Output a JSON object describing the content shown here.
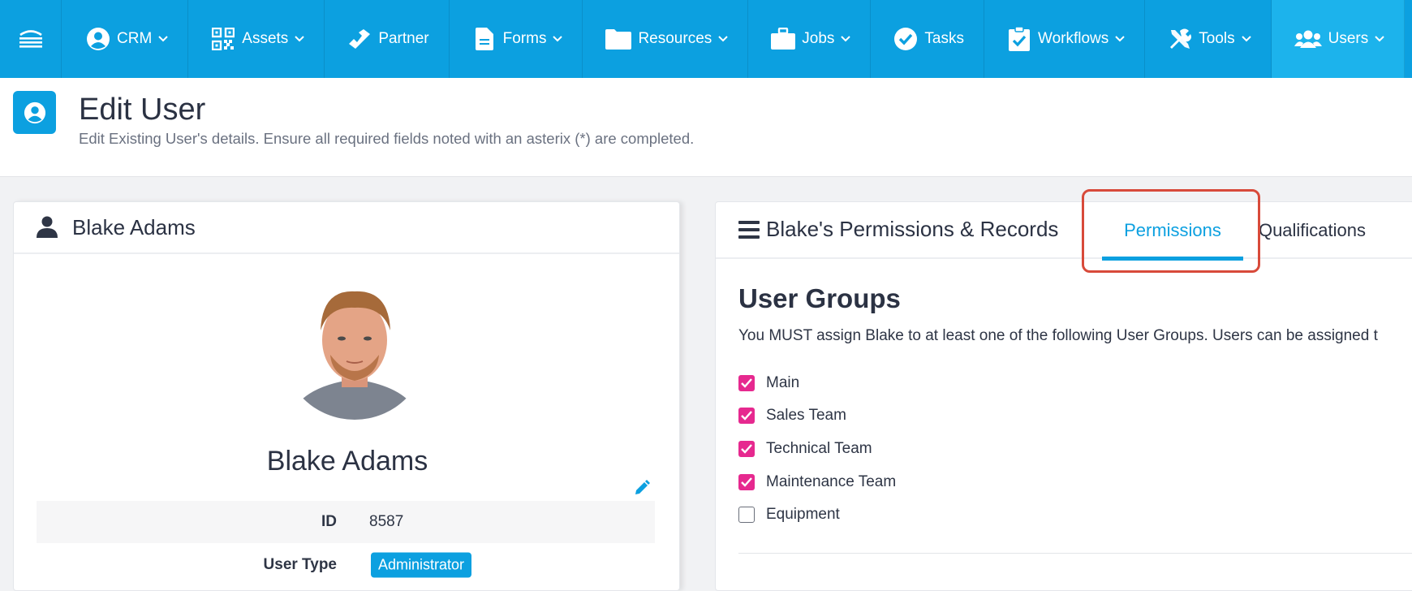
{
  "nav": {
    "logo_icon": "stack-layers-icon",
    "items": [
      {
        "label": "CRM",
        "icon": "user-circle-icon",
        "dropdown": true
      },
      {
        "label": "Assets",
        "icon": "qr-code-icon",
        "dropdown": true
      },
      {
        "label": "Partner",
        "icon": "handshake-icon",
        "dropdown": false
      },
      {
        "label": "Forms",
        "icon": "document-icon",
        "dropdown": true
      },
      {
        "label": "Resources",
        "icon": "folder-icon",
        "dropdown": true
      },
      {
        "label": "Jobs",
        "icon": "briefcase-icon",
        "dropdown": true
      },
      {
        "label": "Tasks",
        "icon": "check-circle-icon",
        "dropdown": false
      },
      {
        "label": "Workflows",
        "icon": "clipboard-check-icon",
        "dropdown": true
      },
      {
        "label": "Tools",
        "icon": "tools-icon",
        "dropdown": true
      },
      {
        "label": "Users",
        "icon": "users-icon",
        "dropdown": true,
        "active": true
      }
    ]
  },
  "page": {
    "title": "Edit User",
    "subtitle": "Edit Existing User's details. Ensure all required fields noted with an asterix (*) are completed."
  },
  "profile": {
    "header_name": "Blake Adams",
    "display_name": "Blake Adams",
    "id_label": "ID",
    "id_value": "8587",
    "type_label": "User Type",
    "type_value": "Administrator"
  },
  "permissions": {
    "card_title": "Blake's Permissions & Records",
    "tabs": [
      {
        "label": "Permissions",
        "active": true
      },
      {
        "label": "Qualifications",
        "active": false
      }
    ],
    "section_title": "User Groups",
    "section_desc": "You MUST assign Blake to at least one of the following User Groups. Users can be assigned t",
    "groups": [
      {
        "label": "Main",
        "checked": true
      },
      {
        "label": "Sales Team",
        "checked": true
      },
      {
        "label": "Technical Team",
        "checked": true
      },
      {
        "label": "Maintenance Team",
        "checked": true
      },
      {
        "label": "Equipment",
        "checked": false
      }
    ]
  },
  "colors": {
    "nav_bg": "#0ca0e0",
    "nav_active": "#1cb3ec",
    "accent": "#0ca0e0",
    "checkbox": "#e6298f",
    "highlight": "#d84a3a"
  }
}
